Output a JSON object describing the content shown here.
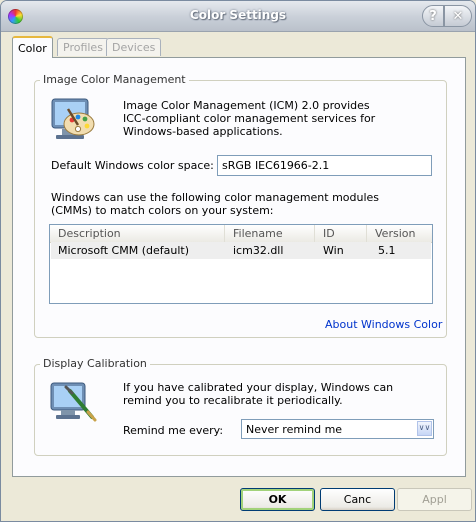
{
  "window": {
    "title": "Color Settings",
    "help_glyph": "?",
    "close_glyph": "✕"
  },
  "tabs": [
    {
      "label": "Color",
      "active": true
    },
    {
      "label": "Profiles",
      "active": false
    },
    {
      "label": "Devices",
      "active": false
    }
  ],
  "icm": {
    "group_title": "Image Color Management",
    "description": "Image Color Management (ICM) 2.0 provides ICC-compliant color management services for Windows-based applications.",
    "color_space_label": "Default Windows color space:",
    "color_space_value": "sRGB IEC61966-2.1",
    "cmm_intro": "Windows can use the following color management modules (CMMs) to match colors on your system:",
    "columns": [
      "Description",
      "Filename",
      "ID",
      "Version"
    ],
    "rows": [
      {
        "description": "Microsoft CMM (default)",
        "filename": "icm32.dll",
        "id": "Win",
        "version": "5.1"
      }
    ],
    "about_link": "About Windows Color"
  },
  "calibration": {
    "group_title": "Display Calibration",
    "description": "If you have calibrated your display, Windows can remind you to recalibrate it periodically.",
    "remind_label": "Remind me every:",
    "remind_value": "Never remind me"
  },
  "buttons": {
    "ok": "OK",
    "cancel": "Canc",
    "apply": "Appl"
  },
  "icons": {
    "app": "color-wheel-icon",
    "icm": "palette-monitor-icon",
    "calibration": "monitor-brush-icon"
  },
  "colors": {
    "accent_tab": "#E7B83E",
    "link": "#0033CC",
    "default_button_glow": "#A2D27A"
  }
}
